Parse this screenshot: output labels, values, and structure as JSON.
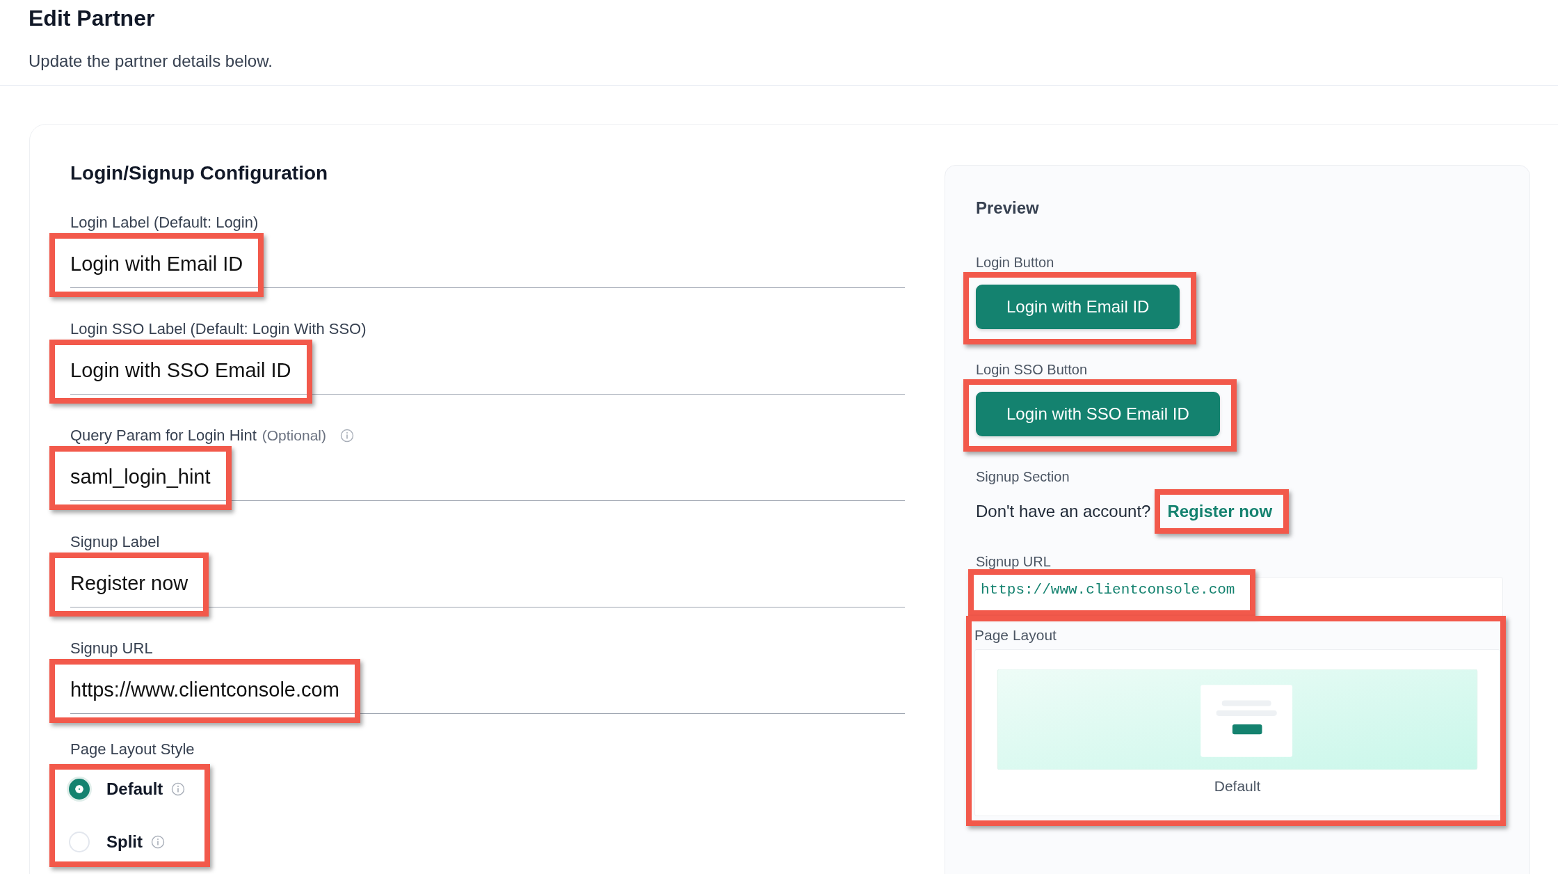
{
  "page": {
    "title": "Edit Partner",
    "subtitle": "Update the partner details below."
  },
  "config": {
    "title": "Login/Signup Configuration",
    "fields": [
      {
        "label": "Login Label (Default: Login)",
        "value": "Login with Email ID",
        "highlighted": true
      },
      {
        "label": "Login SSO Label (Default: Login With SSO)",
        "value": "Login with SSO Email ID",
        "highlighted": true
      },
      {
        "label": "Query Param for Login Hint",
        "note": "(Optional)",
        "info": true,
        "value": "saml_login_hint",
        "highlighted": true
      },
      {
        "label": "Signup Label",
        "value": "Register now",
        "highlighted": true
      },
      {
        "label": "Signup URL",
        "value": "https://www.clientconsole.com",
        "highlighted": true
      }
    ],
    "layout_style": {
      "label": "Page Layout Style",
      "highlighted": true,
      "options": [
        {
          "label": "Default",
          "selected": true,
          "info": true
        },
        {
          "label": "Split",
          "selected": false,
          "info": true
        }
      ]
    }
  },
  "preview": {
    "title": "Preview",
    "buttons": [
      {
        "label": "Login Button",
        "text": "Login with Email ID",
        "highlighted": true
      },
      {
        "label": "Login SSO Button",
        "text": "Login with SSO Email ID",
        "highlighted": true
      }
    ],
    "signup": {
      "label": "Signup Section",
      "prompt": "Don't have an account?",
      "link": "Register now",
      "highlighted": true
    },
    "signup_url": {
      "label": "Signup URL",
      "value": "https://www.clientconsole.com",
      "highlighted": true
    },
    "page_layout": {
      "label": "Page Layout",
      "caption": "Default",
      "highlighted": true
    }
  }
}
